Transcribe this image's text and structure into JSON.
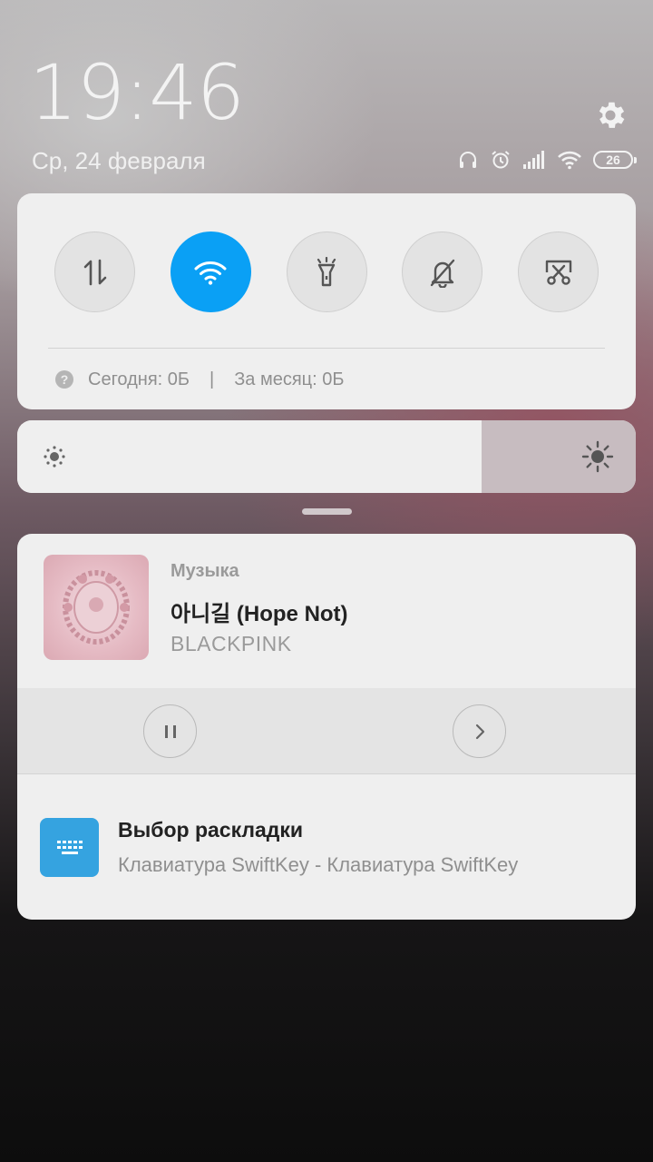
{
  "header": {
    "time": "19:46",
    "date": "Ср, 24 февраля",
    "battery": "26"
  },
  "quick_toggles": [
    {
      "name": "mobile-data",
      "icon": "updown-arrows-icon",
      "active": false
    },
    {
      "name": "wifi",
      "icon": "wifi-icon",
      "active": true
    },
    {
      "name": "flashlight",
      "icon": "flashlight-icon",
      "active": false
    },
    {
      "name": "silent",
      "icon": "bell-off-icon",
      "active": false
    },
    {
      "name": "screenshot",
      "icon": "scissors-icon",
      "active": false
    }
  ],
  "data_usage": {
    "help": "?",
    "today": "Сегодня: 0Б",
    "separator": "|",
    "month": "За месяц: 0Б"
  },
  "brightness": {
    "level": 0.75
  },
  "music": {
    "app": "Музыка",
    "title": "아니길 (Hope Not)",
    "artist": "BLACKPINK"
  },
  "keyboard": {
    "title": "Выбор раскладки",
    "text": "Клавиатура SwiftKey - Клавиатура SwiftKey"
  },
  "colors": {
    "accent": "#0aa0f5",
    "keyboard_icon": "#35a3e0"
  }
}
